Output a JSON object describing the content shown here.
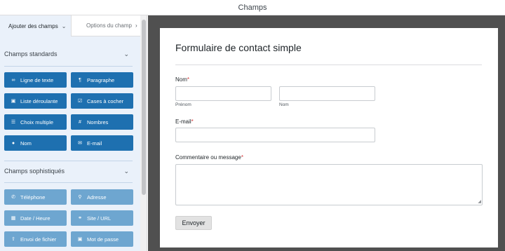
{
  "window": {
    "title": "Champs"
  },
  "sidebar": {
    "tabs": [
      {
        "label": "Ajouter des champs",
        "chevron": "chevron-down-icon"
      },
      {
        "label": "Options du champ",
        "chevron": "chevron-right-icon"
      }
    ],
    "standard_section": {
      "title": "Champs standards",
      "fields": [
        {
          "label": "Ligne de texte",
          "icon": "text-line-icon"
        },
        {
          "label": "Paragraphe",
          "icon": "paragraph-icon"
        },
        {
          "label": "Liste déroulante",
          "icon": "dropdown-icon"
        },
        {
          "label": "Cases à cocher",
          "icon": "checkbox-icon"
        },
        {
          "label": "Choix multiple",
          "icon": "list-icon"
        },
        {
          "label": "Nombres",
          "icon": "hash-icon"
        },
        {
          "label": "Nom",
          "icon": "user-icon"
        },
        {
          "label": "E-mail",
          "icon": "mail-icon"
        }
      ]
    },
    "advanced_section": {
      "title": "Champs sophistiqués",
      "fields": [
        {
          "label": "Téléphone",
          "icon": "phone-icon"
        },
        {
          "label": "Adresse",
          "icon": "map-pin-icon"
        },
        {
          "label": "Date / Heure",
          "icon": "calendar-icon"
        },
        {
          "label": "Site / URL",
          "icon": "link-icon"
        },
        {
          "label": "Envoi de fichier",
          "icon": "upload-icon"
        },
        {
          "label": "Mot de passe",
          "icon": "lock-icon"
        }
      ]
    }
  },
  "form": {
    "title": "Formulaire de contact simple",
    "name_label": "Nom",
    "first_name_sublabel": "Prénom",
    "last_name_sublabel": "Nom",
    "email_label": "E-mail",
    "comment_label": "Commentaire ou message",
    "required_marker": "*",
    "submit_label": "Envoyer"
  },
  "colors": {
    "standard_button": "#1e70b0",
    "advanced_button": "#6ea6d0",
    "sidebar_bg": "#eaf1fa",
    "preview_bg": "#505050",
    "required": "#d63638"
  }
}
